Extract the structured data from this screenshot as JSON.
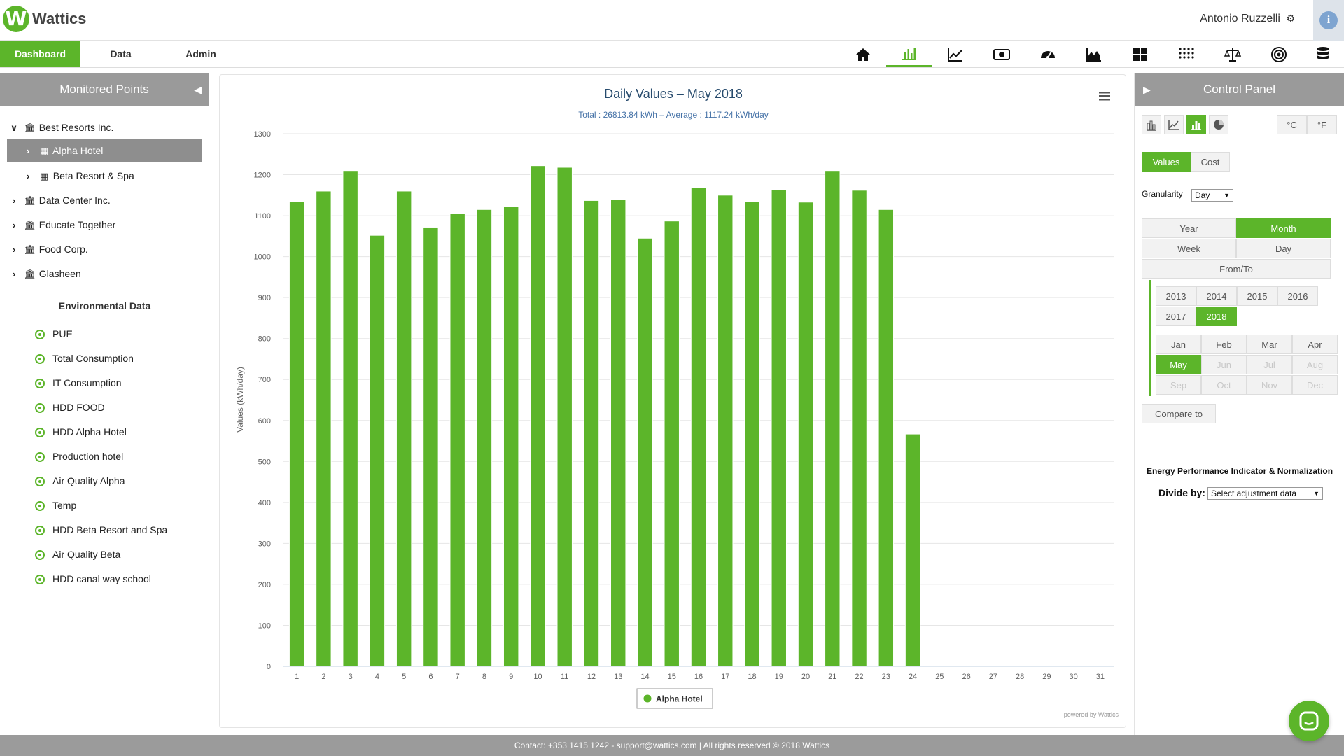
{
  "app": {
    "brand": "Wattics",
    "logo_letter": "W"
  },
  "user": {
    "name": "Antonio Ruzzelli",
    "info_icon": "i"
  },
  "nav": {
    "tabs": [
      {
        "label": "Dashboard",
        "active": true
      },
      {
        "label": "Data"
      },
      {
        "label": "Admin"
      }
    ],
    "icons": [
      "home-icon",
      "bar-chart-icon",
      "line-chart-icon",
      "money-icon",
      "gauge-icon",
      "area-chart-icon",
      "grid-icon",
      "dot-matrix-icon",
      "balance-icon",
      "target-icon",
      "database-icon"
    ],
    "active_icon": "bar-chart-icon"
  },
  "left": {
    "title": "Monitored Points",
    "tree": [
      {
        "label": "Best Resorts Inc.",
        "level": 0,
        "expanded": true,
        "icon": "bank-icon"
      },
      {
        "label": "Alpha Hotel",
        "level": 1,
        "selected": true,
        "icon": "building-icon"
      },
      {
        "label": "Beta Resort & Spa",
        "level": 1,
        "icon": "building-icon"
      },
      {
        "label": "Data Center Inc.",
        "level": 0,
        "icon": "bank-icon"
      },
      {
        "label": "Educate Together",
        "level": 0,
        "icon": "bank-icon"
      },
      {
        "label": "Food Corp.",
        "level": 0,
        "icon": "bank-icon"
      },
      {
        "label": "Glasheen",
        "level": 0,
        "icon": "bank-icon"
      }
    ],
    "env_title": "Environmental Data",
    "env_items": [
      "PUE",
      "Total Consumption",
      "IT Consumption",
      "HDD FOOD",
      "HDD Alpha Hotel",
      "Production hotel",
      "Air Quality Alpha",
      "Temp",
      "HDD Beta Resort and Spa",
      "Air Quality Beta",
      "HDD canal way school"
    ]
  },
  "chart_data": {
    "type": "bar",
    "title": "Daily Values – May 2018",
    "subtitle": "Total : 26813.84 kWh – Average : 1117.24 kWh/day",
    "ylabel": "Values (kWh/day)",
    "ylim": [
      0,
      1300
    ],
    "yticks": [
      0,
      100,
      200,
      300,
      400,
      500,
      600,
      700,
      800,
      900,
      1000,
      1100,
      1200,
      1300
    ],
    "categories": [
      "1",
      "2",
      "3",
      "4",
      "5",
      "6",
      "7",
      "8",
      "9",
      "10",
      "11",
      "12",
      "13",
      "14",
      "15",
      "16",
      "17",
      "18",
      "19",
      "20",
      "21",
      "22",
      "23",
      "24",
      "25",
      "26",
      "27",
      "28",
      "29",
      "30",
      "31"
    ],
    "series": [
      {
        "name": "Alpha Hotel",
        "color": "#5cb52a",
        "values": [
          1135,
          1160,
          1210,
          1052,
          1160,
          1072,
          1105,
          1115,
          1122,
          1222,
          1218,
          1137,
          1140,
          1045,
          1087,
          1168,
          1150,
          1135,
          1163,
          1133,
          1210,
          1162,
          1115,
          567,
          null,
          null,
          null,
          null,
          null,
          null,
          null
        ]
      }
    ],
    "grid": true,
    "legend_position": "bottom-center",
    "credit": "powered by Wattics"
  },
  "control": {
    "title": "Control Panel",
    "chart_types": [
      "bar-compare-icon",
      "line-compare-icon",
      "bar-chart-icon",
      "pie-chart-icon"
    ],
    "active_chart_type": "bar-chart-icon",
    "units": [
      "°C",
      "°F"
    ],
    "mode": [
      "Values",
      "Cost"
    ],
    "granularity_label": "Granularity",
    "granularity_value": "Day",
    "periods": [
      "Year",
      "Month",
      "Week",
      "Day",
      "From/To"
    ],
    "active_period": "Month",
    "years": [
      "2013",
      "2014",
      "2015",
      "2016",
      "2017",
      "2018"
    ],
    "active_year": "2018",
    "months": [
      "Jan",
      "Feb",
      "Mar",
      "Apr",
      "May",
      "Jun",
      "Jul",
      "Aug",
      "Sep",
      "Oct",
      "Nov",
      "Dec"
    ],
    "active_month": "May",
    "compare_label": "Compare to",
    "epi_link": "Energy Performance Indicator & Normalization",
    "divide_label": "Divide by:",
    "divide_value": "Select adjustment data"
  },
  "footer": {
    "text": "Contact: +353 1415 1242 - support@wattics.com | All rights reserved © 2018 Wattics"
  }
}
